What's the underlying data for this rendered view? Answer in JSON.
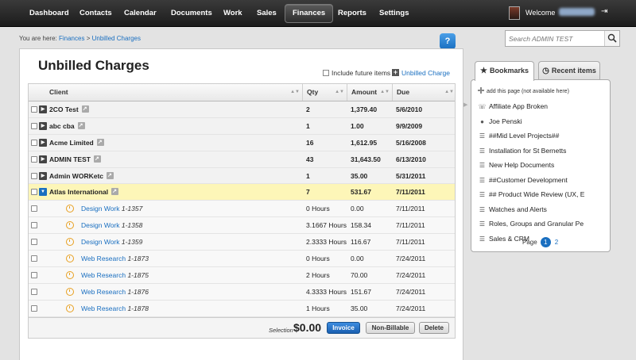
{
  "nav": {
    "items": [
      "Dashboard",
      "Contacts",
      "Calendar",
      "Documents",
      "Work",
      "Sales",
      "Finances",
      "Reports",
      "Settings"
    ],
    "active": "Finances",
    "welcome": "Welcome"
  },
  "breadcrumb": {
    "prefix": "You are here:",
    "crumb1": "Finances",
    "separator": ">",
    "crumb2": "Unbilled Charges"
  },
  "search": {
    "placeholder": "Search ADMIN TEST"
  },
  "help": {
    "icon_text": "?"
  },
  "page": {
    "title": "Unbilled Charges",
    "include_future_label": "Include future items",
    "unbilled_charge_link": "Unbilled Charge",
    "add_icon_text": "+"
  },
  "table": {
    "columns": [
      "Client",
      "Qty",
      "Amount",
      "Due"
    ],
    "rows": [
      {
        "type": "parent",
        "client": "2CO Test",
        "qty": "2",
        "amount": "1,379.40",
        "due": "5/6/2010"
      },
      {
        "type": "parent",
        "client": "abc cba",
        "qty": "1",
        "amount": "1.00",
        "due": "9/9/2009"
      },
      {
        "type": "parent",
        "client": "Acme Limited",
        "qty": "16",
        "amount": "1,612.95",
        "due": "5/16/2008"
      },
      {
        "type": "parent",
        "client": "ADMIN TEST",
        "qty": "43",
        "amount": "31,643.50",
        "due": "6/13/2010"
      },
      {
        "type": "parent",
        "client": "Admin WORKetc",
        "qty": "1",
        "amount": "35.00",
        "due": "5/31/2011"
      },
      {
        "type": "expanded",
        "client": "Atlas International",
        "qty": "7",
        "amount": "531.67",
        "due": "7/11/2011"
      },
      {
        "type": "child",
        "task": "Design Work",
        "task_id": "1-1357",
        "qty": "0 Hours",
        "amount": "0.00",
        "due": "7/11/2011"
      },
      {
        "type": "child",
        "task": "Design Work",
        "task_id": "1-1358",
        "qty": "3.1667 Hours",
        "amount": "158.34",
        "due": "7/11/2011"
      },
      {
        "type": "child",
        "task": "Design Work",
        "task_id": "1-1359",
        "qty": "2.3333 Hours",
        "amount": "116.67",
        "due": "7/11/2011"
      },
      {
        "type": "child",
        "task": "Web Research",
        "task_id": "1-1873",
        "qty": "0 Hours",
        "amount": "0.00",
        "due": "7/24/2011"
      },
      {
        "type": "child",
        "task": "Web Research",
        "task_id": "1-1875",
        "qty": "2 Hours",
        "amount": "70.00",
        "due": "7/24/2011"
      },
      {
        "type": "child",
        "task": "Web Research",
        "task_id": "1-1876",
        "qty": "4.3333 Hours",
        "amount": "151.67",
        "due": "7/24/2011"
      },
      {
        "type": "child",
        "task": "Web Research",
        "task_id": "1-1878",
        "qty": "1 Hours",
        "amount": "35.00",
        "due": "7/24/2011"
      }
    ],
    "footer": {
      "selection_label": "Selection",
      "selection_value": "$0.00",
      "invoice_label": "Invoice",
      "nonbillable_label": "Non-Billable",
      "delete_label": "Delete"
    }
  },
  "sidebar": {
    "tabs": [
      "Bookmarks",
      "Recent items"
    ],
    "add_page": "add this page (not available here)",
    "bookmarks": [
      {
        "icon": "headset-icon",
        "label": "Affiliate App Broken"
      },
      {
        "icon": "person-icon",
        "label": "Joe Penski"
      },
      {
        "icon": "project-icon",
        "label": "##Mid Level Projects##"
      },
      {
        "icon": "project-icon",
        "label": "Installation for St Bernetts"
      },
      {
        "icon": "project-icon",
        "label": "New Help Documents"
      },
      {
        "icon": "project-icon",
        "label": "##Customer Development"
      },
      {
        "icon": "project-icon",
        "label": "## Product Wide Review (UX, E"
      },
      {
        "icon": "project-icon",
        "label": "Watches and Alerts"
      },
      {
        "icon": "project-icon",
        "label": "Roles, Groups and Granular Pe"
      },
      {
        "icon": "project-icon",
        "label": "Sales & CRM"
      }
    ],
    "pagination": {
      "label": "Page",
      "current": "1",
      "next": "2"
    }
  },
  "colors": {
    "accent": "#1a6fc0",
    "highlight": "#fdf6b8",
    "nav_bg": "#2a2a2a"
  }
}
